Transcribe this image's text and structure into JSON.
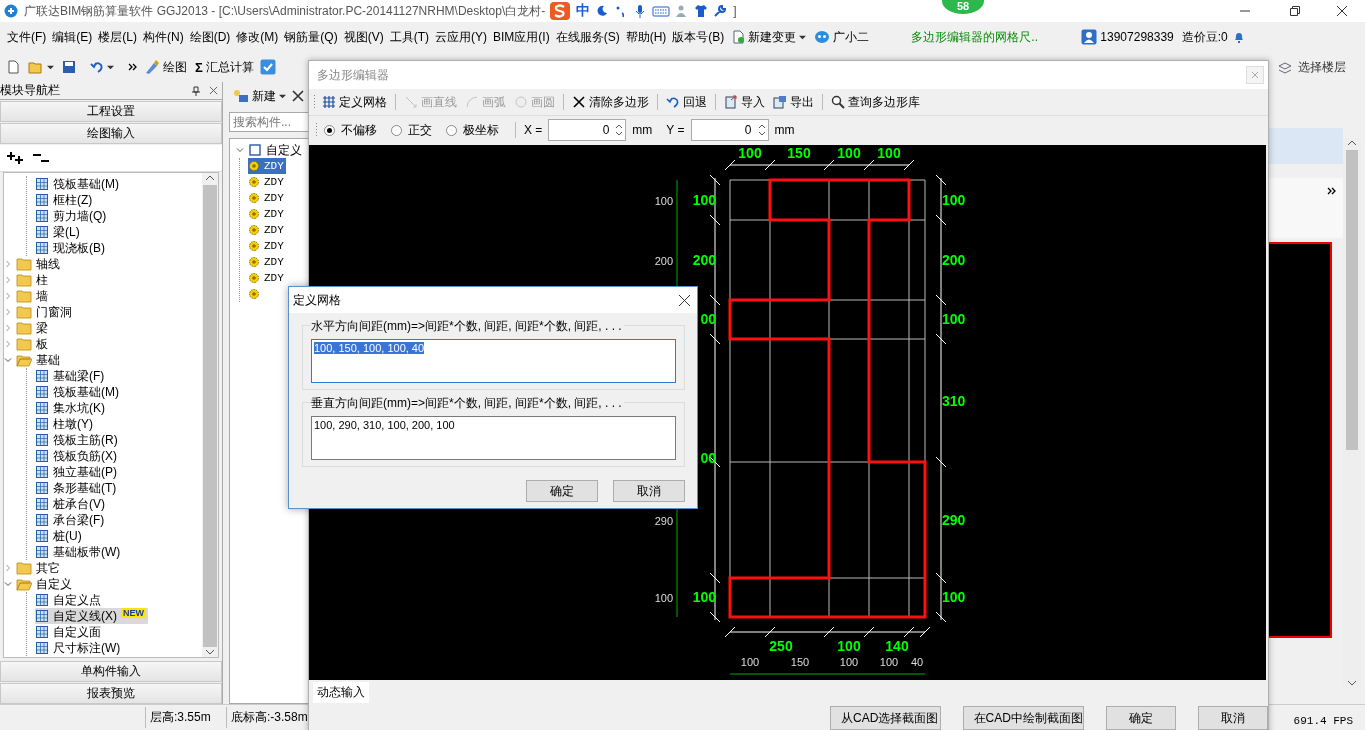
{
  "title_bar": {
    "title": "广联达BIM钢筋算量软件 GGJ2013 - [C:\\Users\\Administrator.PC-20141127NRHM\\Desktop\\白龙村-",
    "ime_mode": "中",
    "title_end": "]",
    "badge": "58"
  },
  "menu_bar": {
    "menus": [
      "文件(F)",
      "编辑(E)",
      "楼层(L)",
      "构件(N)",
      "绘图(D)",
      "修改(M)",
      "钢筋量(Q)",
      "视图(V)",
      "工具(T)",
      "云应用(Y)",
      "BIM应用(I)",
      "在线服务(S)",
      "帮助(H)",
      "版本号(B)"
    ],
    "new_change": "新建变更",
    "assistant": "广小二",
    "marquee": "多边形编辑器的网格尺..",
    "phone": "13907298339",
    "beans": "造价豆:0"
  },
  "toolbar": {
    "draw": "绘图",
    "sum_symbol": "Σ",
    "sum": "汇总计算",
    "floor_select": "选择楼层"
  },
  "nav": {
    "title": "模块导航栏",
    "sections": [
      "工程设置",
      "绘图输入"
    ],
    "tree": [
      {
        "expanded": true,
        "children": [
          {
            "label": "筏板基础(M)",
            "selected": false
          },
          {
            "label": "框柱(Z)",
            "selected": false
          },
          {
            "label": "剪力墙(Q)",
            "selected": false
          },
          {
            "label": "梁(L)",
            "selected": false
          },
          {
            "label": "现浇板(B)",
            "selected": false
          }
        ]
      },
      {
        "label": "轴线",
        "expanded": false,
        "selected": false
      },
      {
        "label": "柱",
        "expanded": false,
        "selected": false
      },
      {
        "label": "墙",
        "expanded": false,
        "selected": false
      },
      {
        "label": "门窗洞",
        "expanded": false,
        "selected": false
      },
      {
        "label": "梁",
        "expanded": false,
        "selected": false
      },
      {
        "label": "板",
        "expanded": false,
        "selected": false
      },
      {
        "label": "基础",
        "expanded": true,
        "selected": false,
        "children": [
          {
            "label": "基础梁(F)",
            "selected": false
          },
          {
            "label": "筏板基础(M)",
            "selected": false
          },
          {
            "label": "集水坑(K)",
            "selected": false
          },
          {
            "label": "柱墩(Y)",
            "selected": false
          },
          {
            "label": "筏板主筋(R)",
            "selected": false
          },
          {
            "label": "筏板负筋(X)",
            "selected": false
          },
          {
            "label": "独立基础(P)",
            "selected": false
          },
          {
            "label": "条形基础(T)",
            "selected": false
          },
          {
            "label": "桩承台(V)",
            "selected": false
          },
          {
            "label": "承台梁(F)",
            "selected": false
          },
          {
            "label": "桩(U)",
            "selected": false
          },
          {
            "label": "基础板带(W)",
            "selected": false
          }
        ]
      },
      {
        "label": "其它",
        "expanded": false,
        "selected": false
      },
      {
        "label": "自定义",
        "expanded": true,
        "selected": false,
        "children": [
          {
            "label": "自定义点",
            "selected": false
          },
          {
            "label": "自定义线(X)",
            "selected": true,
            "badge": "NEW"
          },
          {
            "label": "自定义面",
            "selected": false
          },
          {
            "label": "尺寸标注(W)",
            "selected": false
          }
        ]
      }
    ],
    "bottom_sections": [
      "单构件输入",
      "报表预览"
    ]
  },
  "components": {
    "new_button": "新建",
    "search_placeholder": "搜索构件...",
    "tree": [
      {
        "label": "自定义",
        "expanded": true,
        "children": [
          {
            "label": "ZDY",
            "selected": true
          },
          {
            "label": "ZDY",
            "selected": false
          },
          {
            "label": "ZDY",
            "selected": false
          },
          {
            "label": "ZDY",
            "selected": false
          },
          {
            "label": "ZDY",
            "selected": false
          },
          {
            "label": "ZDY",
            "selected": false
          },
          {
            "label": "ZDY",
            "selected": false
          },
          {
            "label": "ZDY",
            "selected": false
          },
          {
            "selected": false
          }
        ]
      }
    ]
  },
  "editor": {
    "title": "多边形编辑器",
    "tools": [
      {
        "label": "定义网格",
        "disabled": false
      },
      {
        "label": "画直线",
        "disabled": true
      },
      {
        "label": "画弧",
        "disabled": true
      },
      {
        "label": "画圆",
        "disabled": true
      },
      {
        "label": "清除多边形",
        "disabled": false
      },
      {
        "label": "回退",
        "disabled": false
      },
      {
        "label": "导入",
        "disabled": false
      },
      {
        "label": "导出",
        "disabled": false
      },
      {
        "label": "查询多边形库",
        "disabled": false
      }
    ],
    "snap_modes": [
      {
        "label": "不偏移",
        "selected": true
      },
      {
        "label": "正交",
        "selected": false
      },
      {
        "label": "极坐标",
        "selected": false
      }
    ],
    "x_label": "X =",
    "x_value": "0",
    "x_unit": "mm",
    "y_label": "Y =",
    "y_value": "0",
    "y_unit": "mm",
    "canvas": {
      "top_labels": [
        "100",
        "150",
        "100",
        "100"
      ],
      "right_labels": [
        "100",
        "200",
        "100",
        "310",
        "290",
        "100"
      ],
      "left_green_labels": [
        "100",
        "200",
        "00",
        "00",
        "100"
      ],
      "left_white_labels": [
        "100",
        "200",
        "290",
        "100"
      ],
      "bottom_green_labels": [
        "250",
        "100",
        "140"
      ],
      "bottom_white_labels": [
        "100",
        "150",
        "100",
        "100",
        "40"
      ]
    },
    "bottom_tab": "动态输入",
    "buttons": [
      "从CAD选择截面图",
      "在CAD中绘制截面图",
      "确定",
      "取消"
    ]
  },
  "dialog": {
    "title": "定义网格",
    "groups": [
      {
        "label": "水平方向间距(mm)=>间距*个数, 间距, 间距*个数, 间距, . . .",
        "value": "100, 150, 100, 100, 40",
        "value_selected": true,
        "focused": true
      },
      {
        "label": "垂直方向间距(mm)=>间距*个数, 间距, 间距*个数, 间距, . . .",
        "value": "100, 290, 310, 100, 200, 100",
        "value_selected": false,
        "focused": false
      }
    ],
    "buttons": [
      "确定",
      "取消"
    ]
  },
  "status_bar": {
    "cells": [
      "层高:3.55m",
      "底标高:-3.58m"
    ],
    "fps": "691.4 FPS"
  }
}
